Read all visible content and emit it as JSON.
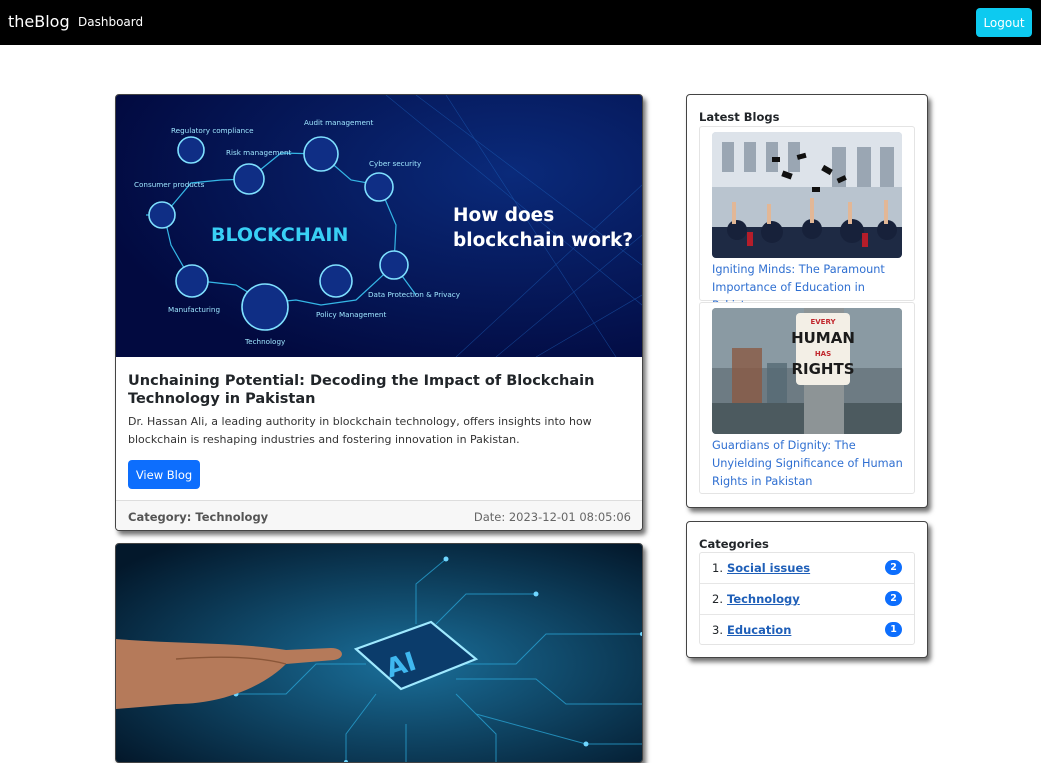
{
  "navbar": {
    "brand": "theBlog",
    "dashboard_label": "Dashboard",
    "logout_label": "Logout"
  },
  "posts": [
    {
      "title": "Unchaining Potential: Decoding the Impact of Blockchain Technology in Pakistan",
      "description": "Dr. Hassan Ali, a leading authority in blockchain technology, offers insights into how blockchain is reshaping industries and fostering innovation in Pakistan.",
      "button_label": "View Blog",
      "category": "Category: Technology",
      "date": "Date: 2023-12-01 08:05:06",
      "image": {
        "headline_line1": "How does",
        "headline_line2": "blockchain work?",
        "center_word": "BLOCKCHAIN",
        "nodes": [
          "Regulatory compliance",
          "Audit management",
          "Risk management",
          "Cyber security",
          "Consumer products",
          "Manufacturing",
          "Technology",
          "Policy Management",
          "Data Protection & Privacy"
        ]
      }
    },
    {
      "image": {
        "chip_text": "AI"
      }
    }
  ],
  "sidebar": {
    "latest_title": "Latest Blogs",
    "latest_blogs": [
      {
        "title": "Igniting Minds: The Paramount Importance of Education in Pakistan"
      },
      {
        "title": "Guardians of Dignity: The Unyielding Significance of Human Rights in Pakistan",
        "image_text": [
          "EVERY",
          "HUMAN",
          "HAS",
          "RIGHTS"
        ]
      }
    ],
    "categories_title": "Categories",
    "categories": [
      {
        "num": "1.",
        "name": "Social issues",
        "count": "2"
      },
      {
        "num": "2.",
        "name": "Technology",
        "count": "2"
      },
      {
        "num": "3.",
        "name": "Education",
        "count": "1"
      }
    ]
  },
  "colors": {
    "navbar": "#000000",
    "logout_button": "#0dcaf0",
    "primary_button": "#0d6efd",
    "link": "#2f6fd1"
  }
}
